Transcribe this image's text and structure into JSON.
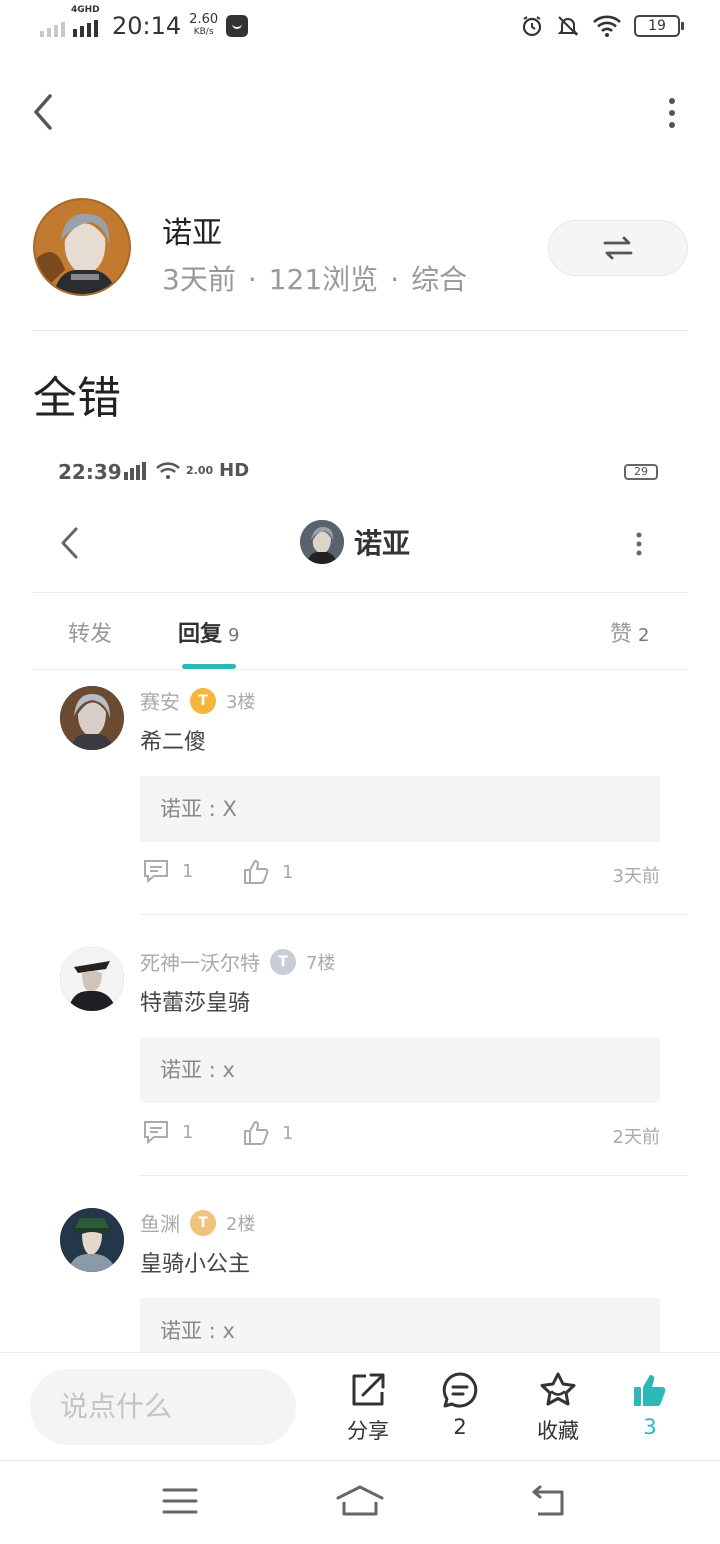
{
  "status_bar": {
    "network": "4GHD",
    "time": "20:14",
    "speed_value": "2.60",
    "speed_unit": "KB/s",
    "battery": "19"
  },
  "author": {
    "name": "诺亚",
    "time": "3天前",
    "views": "121浏览",
    "category": "综合"
  },
  "post": {
    "title": "全错"
  },
  "embedded": {
    "status_time": "22:39",
    "status_speed": "2.00",
    "status_hd": "HD",
    "battery": "29",
    "title": "诺亚",
    "tabs": [
      {
        "label": "转发",
        "count": ""
      },
      {
        "label": "回复",
        "count": "9"
      },
      {
        "label": "赞",
        "count": "2"
      }
    ],
    "replies": [
      {
        "user": "赛安",
        "badge": "T",
        "floor": "3楼",
        "text": "希二傻",
        "quote_user": "诺亚",
        "quote_text": "X",
        "comments": "1",
        "likes": "1",
        "time": "3天前"
      },
      {
        "user": "死神一沃尔特",
        "badge": "T",
        "floor": "7楼",
        "text": "特蕾莎皇骑",
        "quote_user": "诺亚",
        "quote_text": "x",
        "comments": "1",
        "likes": "1",
        "time": "2天前"
      },
      {
        "user": "鱼渊",
        "badge": "T",
        "floor": "2楼",
        "text": "皇骑小公主",
        "quote_user": "诺亚",
        "quote_text": "x",
        "comments": "",
        "likes": "",
        "time": ""
      }
    ]
  },
  "bottom_bar": {
    "input_placeholder": "说点什么",
    "share_label": "分享",
    "comment_count": "2",
    "favorite_label": "收藏",
    "like_count": "3",
    "accent_color": "#2db8b8"
  }
}
